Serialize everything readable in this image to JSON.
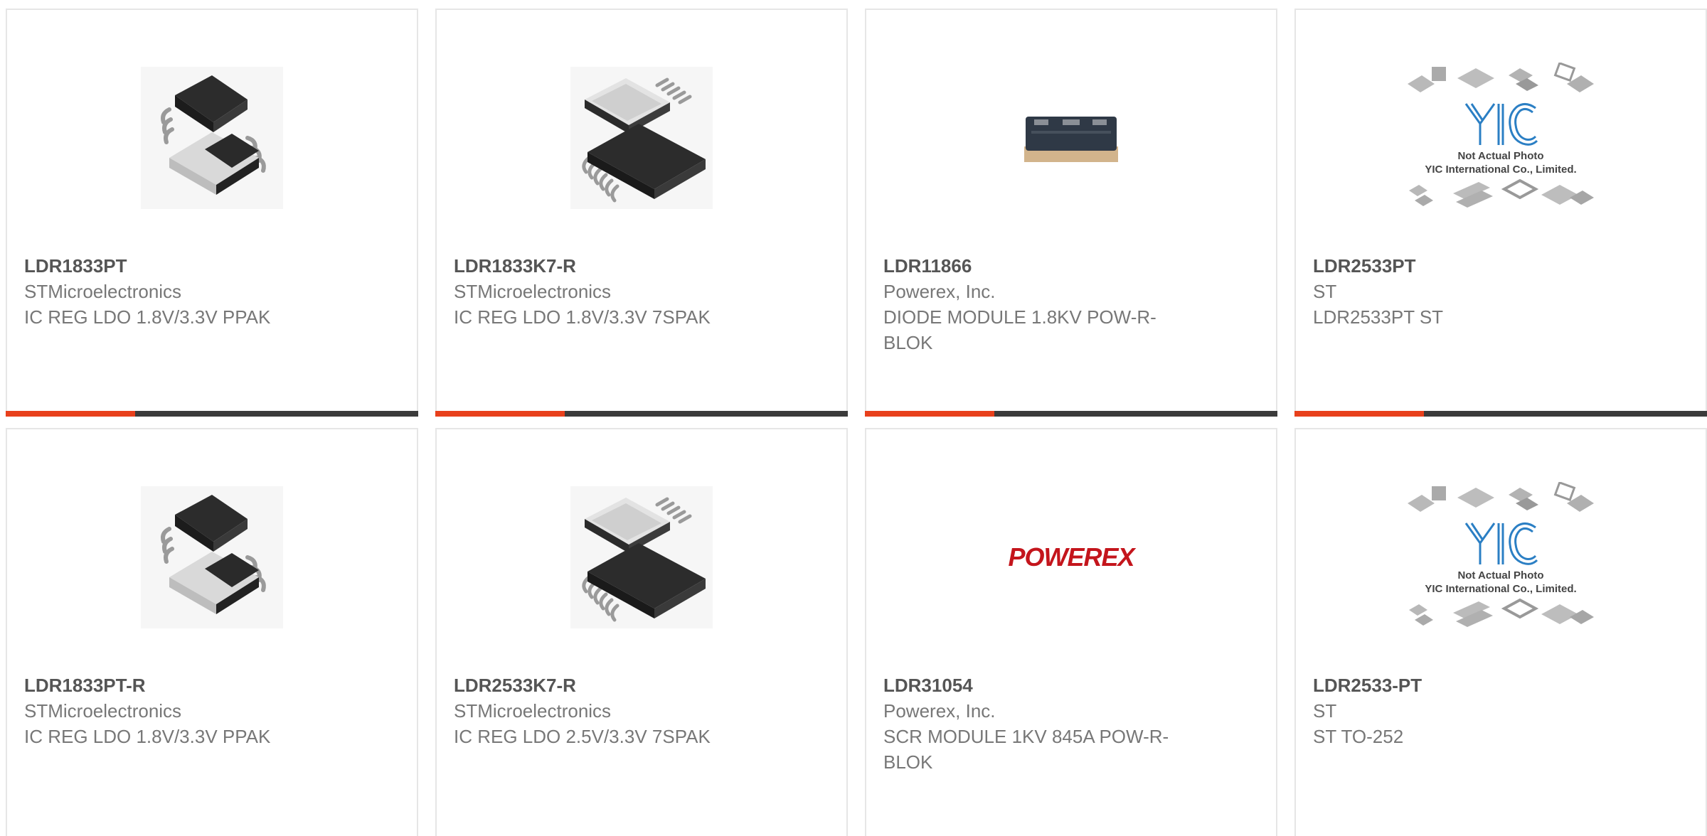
{
  "colors": {
    "accent": "#e8401c",
    "bar": "#3b3b3b",
    "border": "#e6e6e6",
    "part_number": "#555555",
    "text": "#777777",
    "powerex_red": "#c4151c",
    "yic_blue": "#2b7fc4"
  },
  "products": [
    {
      "part_number": "LDR1833PT",
      "manufacturer": "STMicroelectronics",
      "description": "IC REG LDO 1.8V/3.3V PPAK",
      "image_icon": "ppak-chip-icon"
    },
    {
      "part_number": "LDR1833K7-R",
      "manufacturer": "STMicroelectronics",
      "description": "IC REG LDO 1.8V/3.3V 7SPAK",
      "image_icon": "7spak-chip-icon"
    },
    {
      "part_number": "LDR11866",
      "manufacturer": "Powerex, Inc.",
      "description": "DIODE MODULE 1.8KV POW-R-BLOK",
      "image_icon": "pow-r-blok-module-icon"
    },
    {
      "part_number": "LDR2533PT",
      "manufacturer": "ST",
      "description": "LDR2533PT ST",
      "image_icon": "placeholder-icon"
    },
    {
      "part_number": "LDR1833PT-R",
      "manufacturer": "STMicroelectronics",
      "description": "IC REG LDO 1.8V/3.3V PPAK",
      "image_icon": "ppak-chip-icon"
    },
    {
      "part_number": "LDR2533K7-R",
      "manufacturer": "STMicroelectronics",
      "description": "IC REG LDO 2.5V/3.3V 7SPAK",
      "image_icon": "7spak-chip-icon"
    },
    {
      "part_number": "LDR31054",
      "manufacturer": "Powerex, Inc.",
      "description": "SCR MODULE 1KV 845A POW-R-BLOK",
      "image_icon": "powerex-logo-icon"
    },
    {
      "part_number": "LDR2533-PT",
      "manufacturer": "ST",
      "description": "ST TO-252",
      "image_icon": "placeholder-icon"
    }
  ],
  "placeholder": {
    "logo": "YIC",
    "line1": "Not Actual Photo",
    "line2": "YIC International Co., Limited."
  },
  "powerex_logo": "POWEREX"
}
